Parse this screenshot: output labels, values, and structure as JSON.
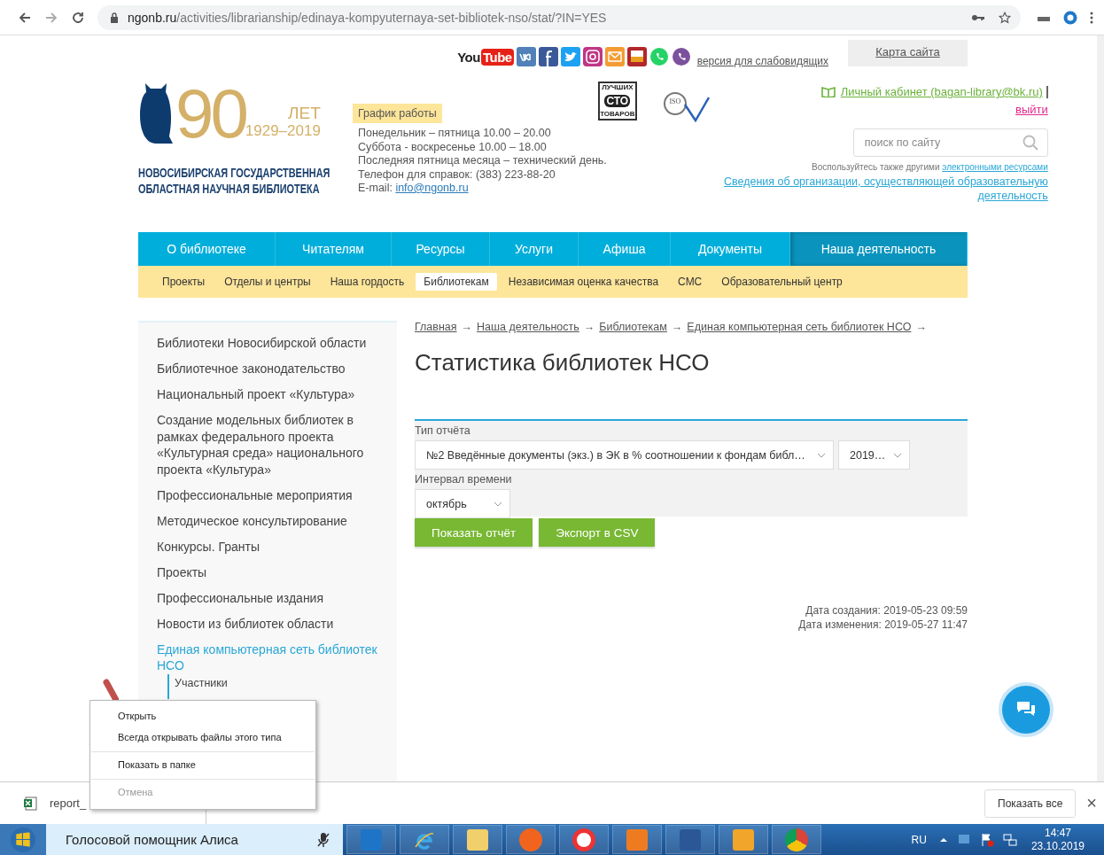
{
  "browser": {
    "url": {
      "host": "ngonb.ru",
      "path": "/activities/librarianship/edinaya-kompyuternaya-set-bibliotek-nso/stat/?IN=YES"
    }
  },
  "header": {
    "youtube": {
      "left": "You",
      "right": "Tube"
    },
    "accessibility_link": "версия для слабовидящих",
    "site_map": "Карта сайта",
    "logo": {
      "big": "90",
      "word": "ЛЕТ",
      "period": "1929–2019",
      "name_lines": [
        "НОВОСИБИРСКАЯ ГОСУДАРСТВЕННАЯ",
        "ОБЛАСТНАЯ НАУЧНАЯ БИБЛИОТЕКА"
      ]
    },
    "schedule": {
      "title": "График работы",
      "lines": [
        "Понедельник – пятница 10.00 – 20.00",
        "Суббота - воскресенье 10.00 – 18.00",
        "Последняя пятница месяца – технический день.",
        "Телефон для справок: (383) 223-88-20"
      ],
      "email_label": "E-mail:",
      "email": "info@ngonb.ru"
    },
    "quality_badge": {
      "lines": [
        "ЛУЧШИХ",
        "СТО",
        "ТОВАРОВ"
      ]
    },
    "iso_badge": {
      "label": "ISO"
    },
    "account_link": "Личный кабинет (bagan-library@bk.ru)",
    "logout": "выйти",
    "search": {
      "placeholder": "поиск по сайту"
    },
    "note": "Воспользуйтесь также другими",
    "note_link": "электронными ресурсами",
    "org_link": "Сведения об организации, осуществляющей образовательную деятельность"
  },
  "nav": [
    {
      "label": "О библиотеке",
      "selected": false
    },
    {
      "label": "Читателям",
      "selected": false
    },
    {
      "label": "Ресурсы",
      "selected": false
    },
    {
      "label": "Услуги",
      "selected": false
    },
    {
      "label": "Афиша",
      "selected": false
    },
    {
      "label": "Документы",
      "selected": false
    },
    {
      "label": "Наша деятельность",
      "selected": true
    }
  ],
  "subnav": [
    {
      "label": "Проекты",
      "selected": false
    },
    {
      "label": "Отделы и центры",
      "selected": false
    },
    {
      "label": "Наша гордость",
      "selected": false
    },
    {
      "label": "Библиотекам",
      "selected": true
    },
    {
      "label": "Независимая оценка качества",
      "selected": false
    },
    {
      "label": "СМС",
      "selected": false
    },
    {
      "label": "Образовательный центр",
      "selected": false
    }
  ],
  "sidebar": {
    "items": [
      {
        "label": "Библиотеки Новосибирской области",
        "selected": false
      },
      {
        "label": "Библиотечное законодательство",
        "selected": false
      },
      {
        "label": "Национальный проект «Культура»",
        "selected": false
      },
      {
        "label": "Создание модельных библиотек в рамках федерального проекта «Культурная среда» национального проекта «Культура»",
        "selected": false
      },
      {
        "label": "Профессиональные мероприятия",
        "selected": false
      },
      {
        "label": "Методическое консультирование",
        "selected": false
      },
      {
        "label": "Конкурсы. Гранты",
        "selected": false
      },
      {
        "label": "Проекты",
        "selected": false
      },
      {
        "label": "Профессиональные издания",
        "selected": false
      },
      {
        "label": "Новости из библиотек области",
        "selected": false
      },
      {
        "label": "Единая компьютерная сеть библиотек НСО",
        "selected": true,
        "children": [
          {
            "label": "Участники",
            "selected": false
          }
        ]
      }
    ]
  },
  "breadcrumbs": {
    "items": [
      "Главная",
      "Наша деятельность",
      "Библиотекам",
      "Единая компьютерная сеть библиотек НСО"
    ],
    "separator": "→"
  },
  "title": "Статистика библиотек НСО",
  "form": {
    "report_label": "Тип отчёта",
    "report_value": "№2 Введённые документы (экз.) в ЭК в % соотношении к фондам библ…",
    "year_value": "2019…",
    "interval_label": "Интервал времени",
    "month_value": "октябрь",
    "buttons": [
      "Показать отчёт",
      "Экспорт в CSV"
    ]
  },
  "dates": [
    "Дата создания: 2019-05-23 09:59",
    "Дата изменения: 2019-05-27 11:47"
  ],
  "context_menu": [
    {
      "label": "Открыть",
      "disabled": false
    },
    {
      "label": "Всегда открывать файлы этого типа",
      "disabled": false
    },
    {
      "label": "Показать в папке",
      "disabled": false
    },
    {
      "label": "Отмена",
      "disabled": true
    }
  ],
  "downloads": {
    "file": "report_",
    "show_all": "Показать все",
    "close": "×"
  },
  "taskbar": {
    "assistant": "Голосовой помощник Алиса",
    "language": "RU",
    "time": "14:47",
    "date": "23.10.2019"
  }
}
